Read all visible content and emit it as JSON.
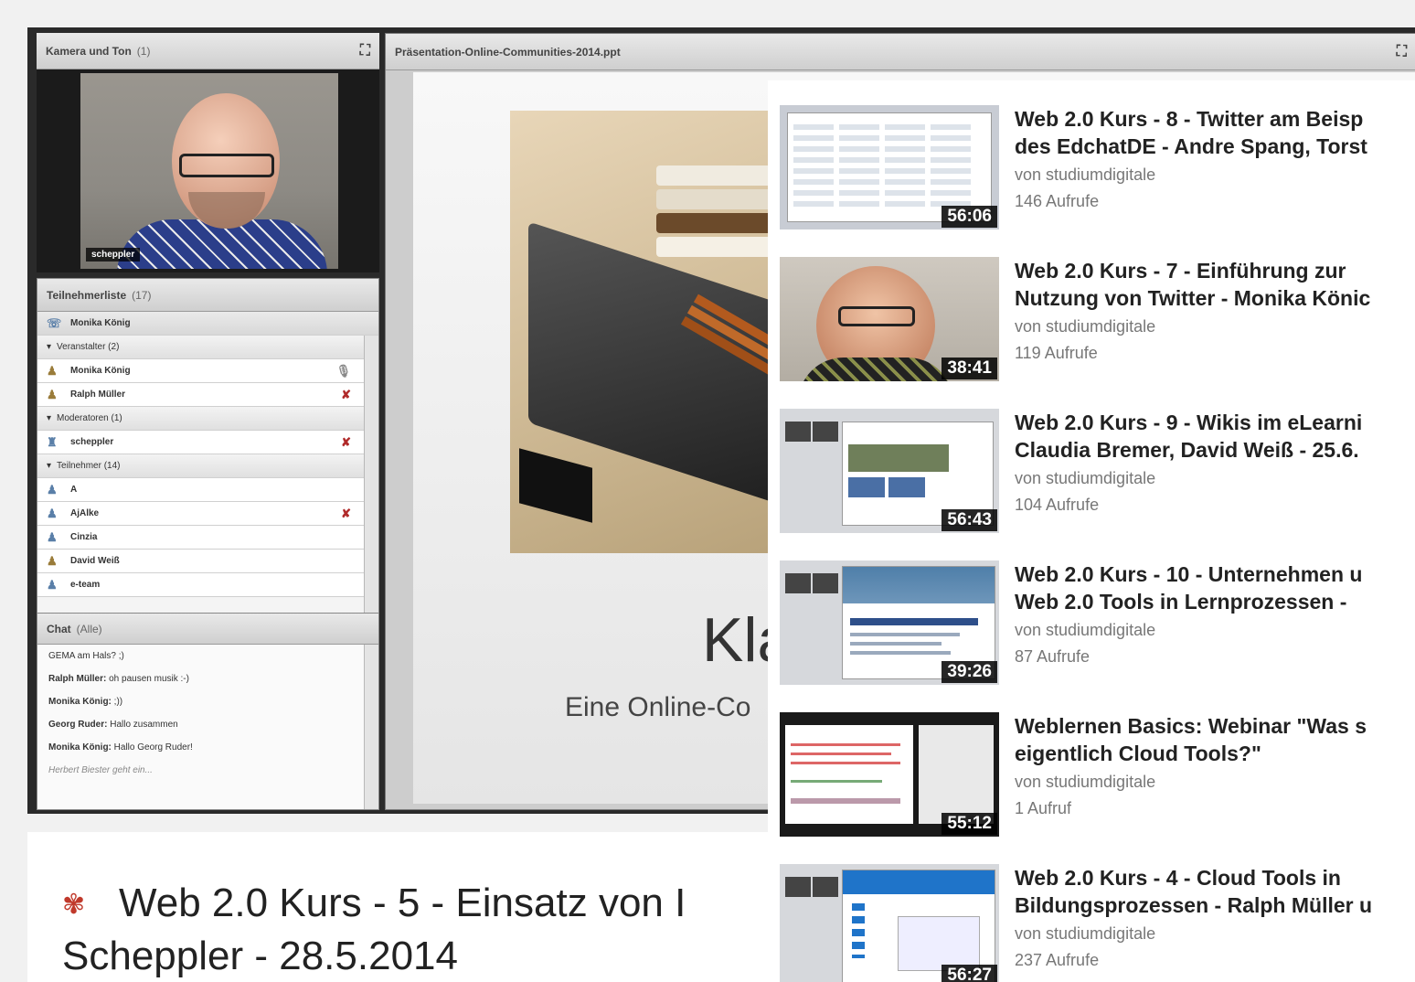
{
  "camera_panel": {
    "title": "Kamera und Ton",
    "count": "(1)",
    "presenter_name": "scheppler"
  },
  "participants": {
    "title": "Teilnehmerliste",
    "count": "(17)",
    "current_user": "Monika König",
    "groups": [
      {
        "label": "Veranstalter (2)",
        "members": [
          {
            "name": "Monika König",
            "mic": "gray"
          },
          {
            "name": "Ralph Müller",
            "mic": "red"
          }
        ]
      },
      {
        "label": "Moderatoren (1)",
        "members": [
          {
            "name": "scheppler",
            "mic": "red"
          }
        ]
      },
      {
        "label": "Teilnehmer (14)",
        "members": [
          {
            "name": "A",
            "mic": ""
          },
          {
            "name": "AjAlke",
            "mic": "red"
          },
          {
            "name": "Cinzia",
            "mic": ""
          },
          {
            "name": "David Weiß",
            "mic": ""
          },
          {
            "name": "e-team",
            "mic": ""
          }
        ]
      }
    ]
  },
  "chat": {
    "title": "Chat",
    "scope": "(Alle)",
    "messages": [
      {
        "author": "",
        "text": "GEMA am Hals? ;)"
      },
      {
        "author": "Ralph Müller:",
        "text": " oh pausen musik :-)"
      },
      {
        "author": "Monika König:",
        "text": " ;))"
      },
      {
        "author": "Georg Ruder:",
        "text": " Hallo zusammen"
      },
      {
        "author": "Monika König:",
        "text": " Hallo Georg Ruder!"
      }
    ],
    "system_message": "Herbert Biester geht ein..."
  },
  "presentation": {
    "filename": "Präsentation-Online-Communities-2014.ppt",
    "slide_title": "Kla",
    "slide_subtitle": "Eine Online-Co"
  },
  "video": {
    "title_line1": "Web 2.0 Kurs - 5 - Einsatz von I",
    "title_line2": "Scheppler - 28.5.2014"
  },
  "related_videos": [
    {
      "title": "Web 2.0 Kurs - 8 - Twitter am Beisp\ndes EdchatDE - Andre Spang, Torst",
      "author": "von studiumdigitale",
      "views": "146 Aufrufe",
      "duration": "56:06",
      "thumb": "twitter-dashboard"
    },
    {
      "title": "Web 2.0 Kurs - 7 - Einführung zur\nNutzung von Twitter - Monika Könic",
      "author": "von studiumdigitale",
      "views": "119 Aufrufe",
      "duration": "38:41",
      "thumb": "webcam-face"
    },
    {
      "title": "Web 2.0 Kurs - 9 - Wikis im eLearni\nClaudia Bremer, David Weiß - 25.6.",
      "author": "von studiumdigitale",
      "views": "104 Aufrufe",
      "duration": "56:43",
      "thumb": "webinar-wiki"
    },
    {
      "title": "Web 2.0 Kurs - 10 - Unternehmen u\nWeb 2.0 Tools in Lernprozessen -",
      "author": "von studiumdigitale",
      "views": "87 Aufrufe",
      "duration": "39:26",
      "thumb": "webinar-slide"
    },
    {
      "title": "Weblernen Basics: Webinar \"Was s\neigentlich Cloud Tools?\"",
      "author": "von studiumdigitale",
      "views": "1 Aufruf",
      "duration": "55:12",
      "thumb": "webinar-dark"
    },
    {
      "title": "Web 2.0 Kurs - 4 - Cloud Tools in\nBildungsprozessen - Ralph Müller u",
      "author": "von studiumdigitale",
      "views": "237 Aufrufe",
      "duration": "56:27",
      "thumb": "onedrive"
    }
  ]
}
